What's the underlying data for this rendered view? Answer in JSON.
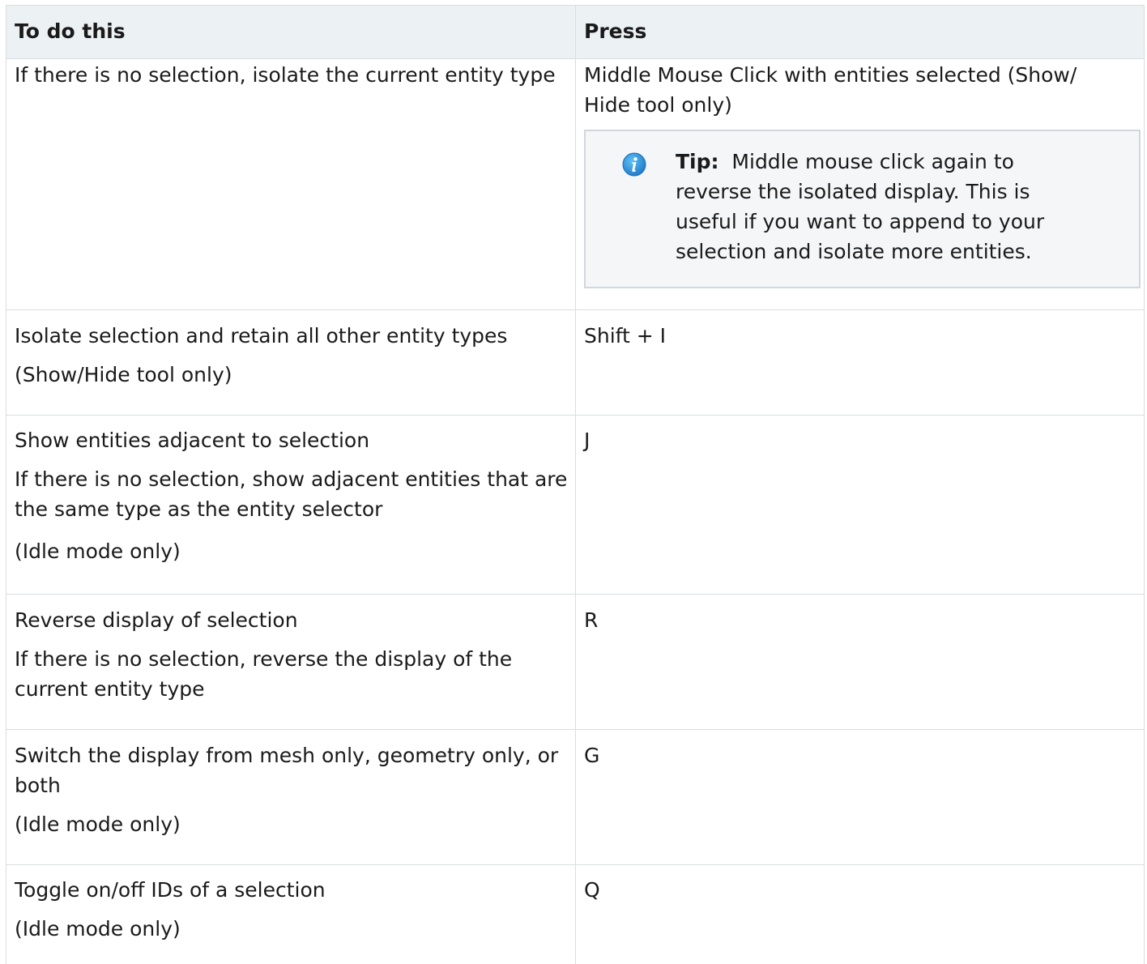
{
  "table": {
    "headers": {
      "col1": "To do this",
      "col2": "Press"
    },
    "rows": [
      {
        "action": [
          "If there is no selection, isolate the current entity type"
        ],
        "press": "Middle Mouse Click with entities selected (Show/ Hide tool only)",
        "tip": {
          "label": "Tip:",
          "text": "Middle mouse click again to reverse the isolated display. This is useful if you want to append to your selection and isolate more entities."
        }
      },
      {
        "action": [
          "Isolate selection and retain all other entity types",
          "(Show/Hide tool only)"
        ],
        "press": "Shift + I"
      },
      {
        "action": [
          "Show entities adjacent to selection",
          "If there is no selection, show adjacent entities that are the same type as the entity selector",
          "(Idle mode only)"
        ],
        "press": "J"
      },
      {
        "action": [
          "Reverse display of selection",
          "If there is no selection, reverse the display of the current entity type"
        ],
        "press": "R"
      },
      {
        "action": [
          "Switch the display from mesh only, geometry only, or both",
          "(Idle mode only)"
        ],
        "press": "G"
      },
      {
        "action": [
          "Toggle on/off IDs of a selection",
          "(Idle mode only)"
        ],
        "press": "Q"
      }
    ]
  },
  "icons": {
    "tip_icon": "info-icon"
  },
  "colors": {
    "header_bg": "#ecf1f4",
    "border": "#dadde0",
    "tip_bg": "#f4f6f8",
    "info_icon": "#1e90d8"
  }
}
